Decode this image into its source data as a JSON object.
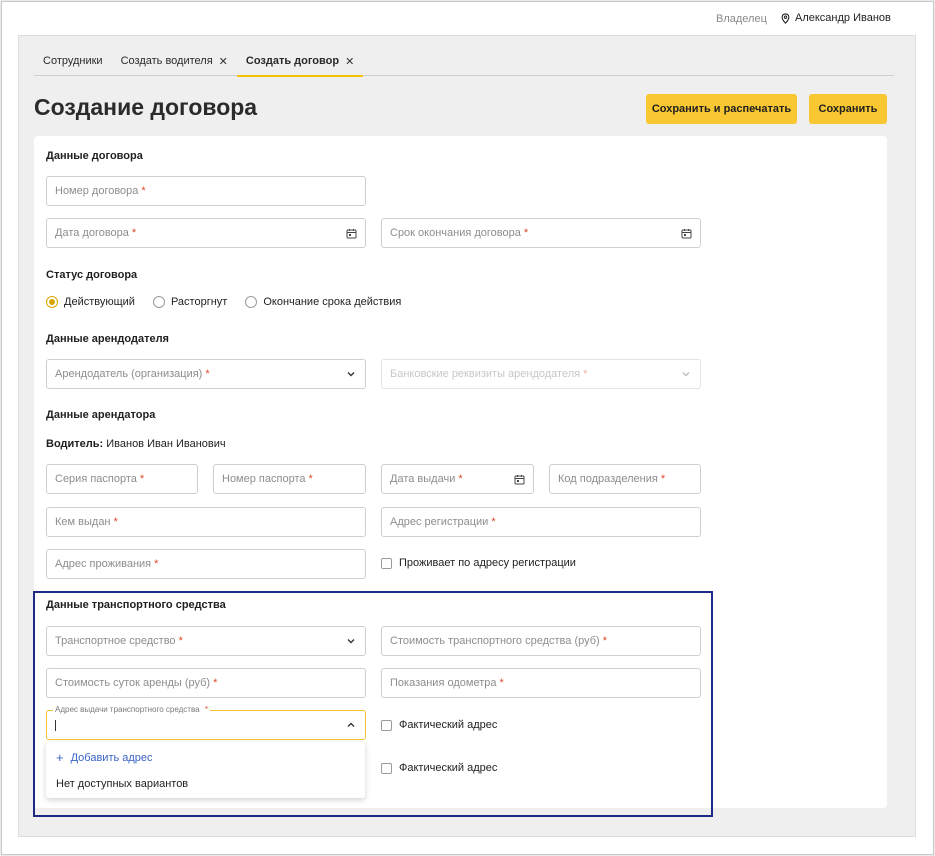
{
  "header": {
    "role": "Владелец",
    "user_name": "Александр Иванов",
    "user_icon": "map-pin-icon"
  },
  "tabs": [
    {
      "label": "Сотрудники",
      "closable": false,
      "active": false
    },
    {
      "label": "Создать водителя",
      "closable": true,
      "active": false
    },
    {
      "label": "Создать договор",
      "closable": true,
      "active": true
    }
  ],
  "close_glyph": "✕",
  "page": {
    "title": "Создание договора",
    "save_print_label": "Сохранить и распечатать",
    "save_label": "Сохранить"
  },
  "colors": {
    "accent": "#f8c732",
    "required": "#e0462b",
    "link": "#3a64c8",
    "highlight_border": "#1d2a86"
  },
  "required_mark": "*",
  "contract": {
    "section": "Данные договора",
    "number_placeholder": "Номер договора",
    "date_placeholder": "Дата договора",
    "end_placeholder": "Срок окончания договора"
  },
  "status": {
    "section": "Статус договора",
    "options": [
      "Действующий",
      "Расторгнут",
      "Окончание срока действия"
    ],
    "selected": "Действующий"
  },
  "landlord": {
    "section": "Данные арендодателя",
    "org_placeholder": "Арендодатель (организация)",
    "bank_placeholder": "Банковские реквизиты арендодателя"
  },
  "tenant": {
    "section": "Данные арендатора",
    "driver_label": "Водитель:",
    "driver_name": "Иванов Иван Иванович",
    "passport_series": "Серия паспорта",
    "passport_number": "Номер паспорта",
    "issue_date": "Дата выдачи",
    "department_code": "Код подразделения",
    "issued_by": "Кем выдан",
    "registration_address": "Адрес регистрации",
    "residence_address": "Адрес проживания",
    "lives_at_registration": "Проживает по адресу регистрации"
  },
  "vehicle": {
    "section": "Данные транспортного средства",
    "vehicle_placeholder": "Транспортное средство",
    "vehicle_cost_placeholder": "Стоимость транспортного средства (руб)",
    "daily_rent_placeholder": "Стоимость суток аренды (руб)",
    "odometer_placeholder": "Показания одометра",
    "issue_address_label": "Адрес выдачи транспортного средства",
    "issue_address_value": "",
    "actual_address_label": "Фактический адрес",
    "actual_address_label_2": "Фактический адрес"
  },
  "address_dropdown": {
    "add_label": "Добавить адрес",
    "empty_label": "Нет доступных вариантов"
  }
}
